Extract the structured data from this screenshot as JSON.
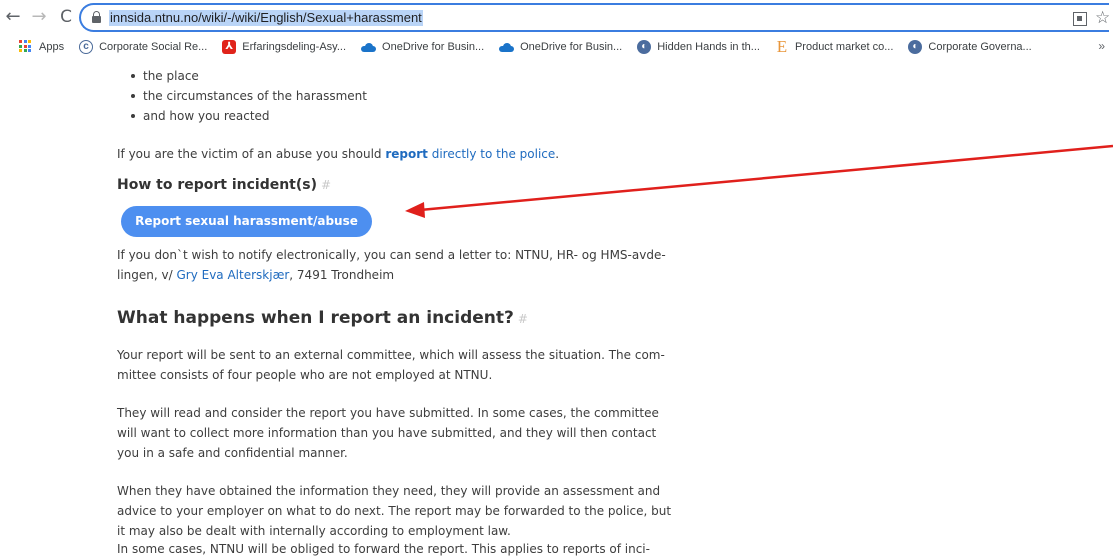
{
  "browser": {
    "nav": {
      "back": "←",
      "forward": "→",
      "reload": "C"
    },
    "url": "innsida.ntnu.no/wiki/-/wiki/English/Sexual+harassment",
    "bookmarks": [
      {
        "label": "Apps",
        "icon": "apps-grid-icon"
      },
      {
        "label": "Corporate Social Re...",
        "icon": "csr-icon"
      },
      {
        "label": "Erfaringsdeling-Asy...",
        "icon": "pdf-icon"
      },
      {
        "label": "OneDrive for Busin...",
        "icon": "onedrive-icon"
      },
      {
        "label": "OneDrive for Busin...",
        "icon": "onedrive-icon"
      },
      {
        "label": "Hidden Hands in th...",
        "icon": "site-icon"
      },
      {
        "label": "Product market co...",
        "icon": "e-icon"
      },
      {
        "label": "Corporate Governa...",
        "icon": "site-icon"
      }
    ],
    "more": "»"
  },
  "page": {
    "bullets": [
      "the place",
      "the circumstances of the harassment",
      "and how you reacted"
    ],
    "victim_text_1": "If you are the victim of an abuse you should ",
    "victim_link_bold": "report",
    "victim_link_rest": " directly to the police",
    "victim_end": ".",
    "how_to_heading": "How to report incident(s)",
    "hash": "#",
    "report_button": "Report sexual harassment/abuse",
    "letter_line1": "If you don`t wish to notify electronically, you can send a letter to: NTNU, HR- og HMS-avde-",
    "letter_line2_a": "lingen, v/ ",
    "letter_link": "Gry Eva Alterskjær",
    "letter_line2_b": ", 7491 Trondheim",
    "what_heading": "What happens when I report an incident?",
    "p1_line1": "Your report will be sent to an external committee, which will assess the situation. The com-",
    "p1_line2": "mittee consists of four people who are not employed at NTNU.",
    "p2_line1": "They will read and consider the report you have submitted. In some cases, the committee",
    "p2_line2": "will want to collect more information than you have submitted, and they will then contact",
    "p2_line3": "you in a safe and confidential manner.",
    "p3_line1": "When they have obtained the information they need, they will provide an assessment and",
    "p3_line2": "advice to your employer on what to do next. The report may be forwarded to the police, but",
    "p3_line3": "it may also be dealt with internally according to employment law.",
    "p4_line1": "In some cases, NTNU will be obliged to forward the report. This applies to reports of inci-"
  },
  "colors": {
    "link": "#1f6bbf",
    "button": "#4d8ff0",
    "annotation_arrow": "#e0201c",
    "omnibox_focus": "#3b7de0"
  }
}
